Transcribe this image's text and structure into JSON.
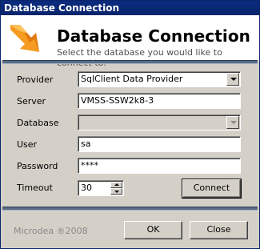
{
  "window": {
    "title": "Database Connection"
  },
  "header": {
    "title": "Database Connection",
    "subtitle": "Select the database you would like to connect to."
  },
  "form": {
    "provider": {
      "label": "Provider",
      "value": "SqlClient Data Provider"
    },
    "server": {
      "label": "Server",
      "value": "VMSS-SSW2k8-3"
    },
    "database": {
      "label": "Database",
      "value": ""
    },
    "user": {
      "label": "User",
      "value": "sa"
    },
    "password": {
      "label": "Password",
      "value": "****"
    },
    "timeout": {
      "label": "Timeout",
      "value": "30"
    },
    "connect_label": "Connect"
  },
  "footer": {
    "copyright": "Microdea ®2008",
    "ok_label": "OK",
    "close_label": "Close"
  },
  "colors": {
    "title_bar": "#0a246a",
    "separator": "#5a6d86",
    "logo_orange": "#f39a1e"
  }
}
